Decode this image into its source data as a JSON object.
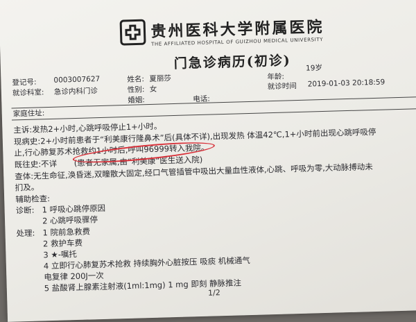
{
  "hospital": {
    "name_zh": "贵州医科大学附属医院",
    "name_en": "THE AFFILIATED HOSPITAL OF GUIZHOU MEDICAL UNIVERSITY",
    "logo_icon": "hospital-cross-logo-icon"
  },
  "document_title": "门急诊病历(初诊)",
  "header": {
    "reg_no_label": "登记号:",
    "reg_no": "0003007627",
    "name_label": "姓名:",
    "name": "夏丽莎",
    "age_label": "年龄:",
    "age": "19岁",
    "dept_label": "就诊科室:",
    "dept": "急诊内科门诊",
    "sex_label": "性别:",
    "sex": "女",
    "visit_time_label": "就诊时间",
    "visit_time": "2019-01-03 20:18:59",
    "marital_label": "婚姻:",
    "phone_label": "电话:",
    "address_label": "家庭住址:"
  },
  "body": {
    "chief_complaint": "主诉:发热2+小时,心跳呼吸停止1+小时。",
    "hpi_1": "现病史:2+小时前患者于“利美康行隆鼻术”后(具体不详),出现发热 体温42℃,1+小时前出现心跳呼吸停",
    "hpi_2": "止,行心肺复苏术抢救约1小时后,呼叫96999转入我院。",
    "past_history_label": "既往史:不详",
    "past_history_note": "(患者无家属,由“利美康”医生送入院)",
    "exam_1": "查体:无生命征,涣昏迷,双瞳散大固定,经口气管插管中吸出大量血性液体,心跳、呼吸为零,大动脉搏动未",
    "exam_2": "扪及。",
    "aux_exam": "辅助检查:",
    "diagnosis_label": "诊断:",
    "diagnoses": [
      "1   呼吸心跳停原因",
      "2   心跳呼吸骤停"
    ],
    "treatment_label": "处理:",
    "treatments": [
      "1   院前急救费",
      "2   救护车费",
      "3   ★-嘱托",
      "4   立即行心肺复苏术抢救 持续胸外心脏按压 吸痰 机械通气",
      "     电复律 200J一次",
      "5   盐酸肾上腺素注射液(1ml:1mg) 1  mg 即刻 静脉推注"
    ]
  },
  "annotation_color": "#d8313a",
  "page_indicator": "1/2"
}
